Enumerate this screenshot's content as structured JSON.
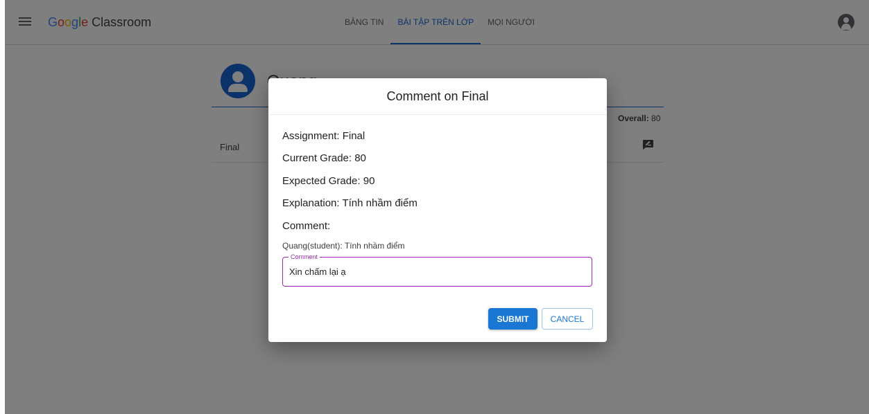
{
  "header": {
    "brand_g1": "G",
    "brand_g2": "o",
    "brand_g3": "o",
    "brand_g4": "g",
    "brand_g5": "l",
    "brand_g6": "e",
    "product": "Classroom",
    "tabs": [
      {
        "label": "BẢNG TIN",
        "active": false
      },
      {
        "label": "BÀI TẬP TRÊN LỚP",
        "active": true
      },
      {
        "label": "MỌI NGƯỜI",
        "active": false
      }
    ]
  },
  "student": {
    "name": "Quang",
    "overall_label": "Overall:",
    "overall_value": "80",
    "grade_rows": [
      {
        "name": "Final"
      }
    ]
  },
  "dialog": {
    "title": "Comment on Final",
    "assignment": "Assignment: Final",
    "current_grade": "Current Grade: 80",
    "expected_grade": "Expected Grade: 90",
    "explanation": "Explanation: Tính nhầm điểm",
    "comment_heading": "Comment:",
    "previous_comment": "Quang(student): Tính nhầm điểm",
    "field_label": "Comment",
    "field_value": "Xin chấm lại ạ",
    "submit_label": "SUBMIT",
    "cancel_label": "CANCEL"
  },
  "colors": {
    "accent": "#1967d2",
    "field_focus": "#9c27b0",
    "overlay": "rgba(0,0,0,0.5)"
  }
}
